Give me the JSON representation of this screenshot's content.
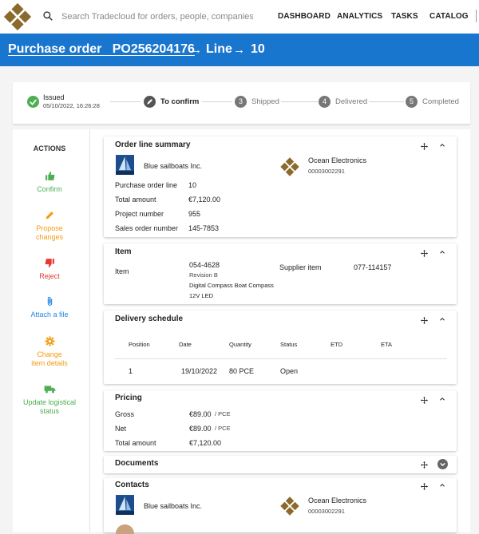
{
  "header": {
    "search_placeholder": "Search Tradecloud for orders, people, companies",
    "nav": [
      "DASHBOARD",
      "ANALYTICS",
      "TASKS",
      "CATALOG"
    ]
  },
  "title": {
    "purchase_order": "Purchase order   PO256204176",
    "line_label": "Line",
    "line_number": "10"
  },
  "stepper": [
    {
      "label": "Issued",
      "sub": "05/10/2022, 16:26:28",
      "state": "done"
    },
    {
      "label": "To confirm",
      "state": "current"
    },
    {
      "number": "3",
      "label": "Shipped",
      "state": "todo"
    },
    {
      "number": "4",
      "label": "Delivered",
      "state": "todo"
    },
    {
      "number": "5",
      "label": "Completed",
      "state": "todo"
    }
  ],
  "actions": {
    "title": "ACTIONS",
    "confirm": "Confirm",
    "propose": [
      "Propose",
      "changes"
    ],
    "reject": "Reject",
    "attach": "Attach a file",
    "change": [
      "Change",
      "item details"
    ],
    "update": [
      "Update logistical",
      "status"
    ]
  },
  "colors": {
    "primary": "#1976cf",
    "confirm": "#4caf50",
    "propose": "#f39c12",
    "reject": "#e53935",
    "attach": "#1e88e5",
    "logo": "#8b6a2b"
  },
  "order_summary": {
    "title": "Order line summary",
    "buyer": "Blue sailboats Inc.",
    "supplier": "Ocean Electronics",
    "supplier_id": "00003002291",
    "rows": [
      {
        "label": "Purchase order line",
        "value": "10"
      },
      {
        "label": "Total amount",
        "value": "€7,120.00"
      },
      {
        "label": "Project number",
        "value": "955"
      },
      {
        "label": "Sales order number",
        "value": "145-7853"
      }
    ]
  },
  "item": {
    "title": "Item",
    "label": "Item",
    "number": "054-4628",
    "revision": "Revision  B",
    "description1": "Digital Compass Boat Compass",
    "description2": "12V LED",
    "supplier_item_label": "Supplier item",
    "supplier_item": "077-114157"
  },
  "delivery": {
    "title": "Delivery schedule",
    "columns": [
      "Position",
      "Date",
      "Quantity",
      "Status",
      "ETD",
      "ETA"
    ],
    "rows": [
      {
        "position": "1",
        "date": "19/10/2022",
        "quantity": "80 PCE",
        "status": "Open",
        "etd": "",
        "eta": ""
      }
    ]
  },
  "pricing": {
    "title": "Pricing",
    "gross_label": "Gross",
    "gross": "€89.00",
    "gross_unit": "/ PCE",
    "net_label": "Net",
    "net": "€89.00",
    "net_unit": "/ PCE",
    "total_label": "Total amount",
    "total": "€7,120.00"
  },
  "documents": {
    "title": "Documents"
  },
  "contacts": {
    "title": "Contacts",
    "buyer": "Blue sailboats Inc.",
    "supplier": "Ocean Electronics",
    "supplier_id": "00003002291"
  }
}
